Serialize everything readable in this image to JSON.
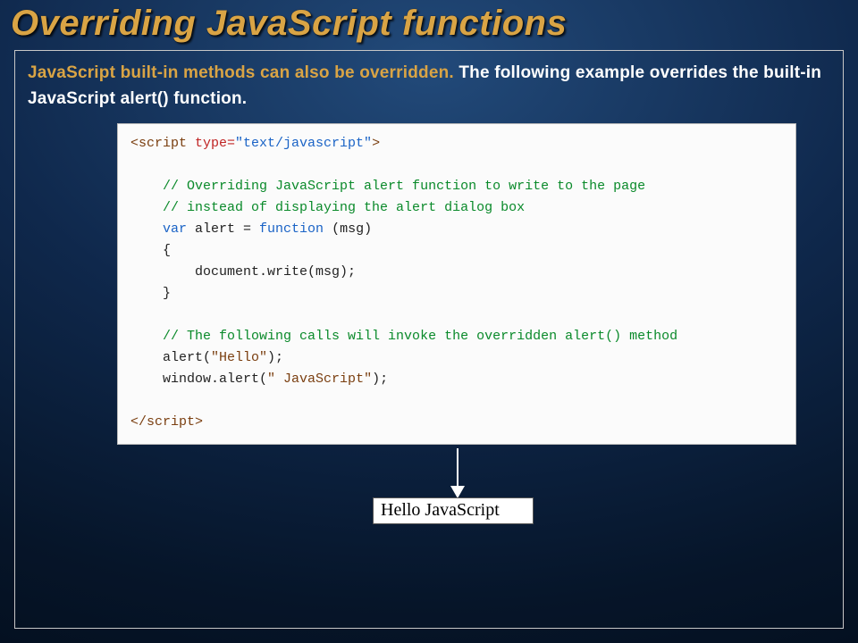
{
  "title": "Overriding JavaScript functions",
  "intro": {
    "accent": "JavaScript built-in methods can also be overridden.",
    "rest": " The following example overrides the built-in JavaScript alert() function."
  },
  "code": {
    "open_tag1": "<script",
    "attr_name": " type=",
    "attr_val": "\"text/javascript\"",
    "open_tag2": ">",
    "c1": "// Overriding JavaScript alert function to write to the page",
    "c2": "// instead of displaying the alert dialog box",
    "kw_var": "var",
    "decl_mid": " alert = ",
    "kw_function": "function",
    "decl_end": " (msg)",
    "brace_open": "{",
    "body": "    document.write(msg);",
    "brace_close": "}",
    "c3": "// The following calls will invoke the overridden alert() method",
    "call1_a": "alert(",
    "call1_s": "\"Hello\"",
    "call1_b": ");",
    "call2_a": "window.alert(",
    "call2_s": "\" JavaScript\"",
    "call2_b": ");",
    "close_tag": "</script>"
  },
  "output": "Hello JavaScript"
}
